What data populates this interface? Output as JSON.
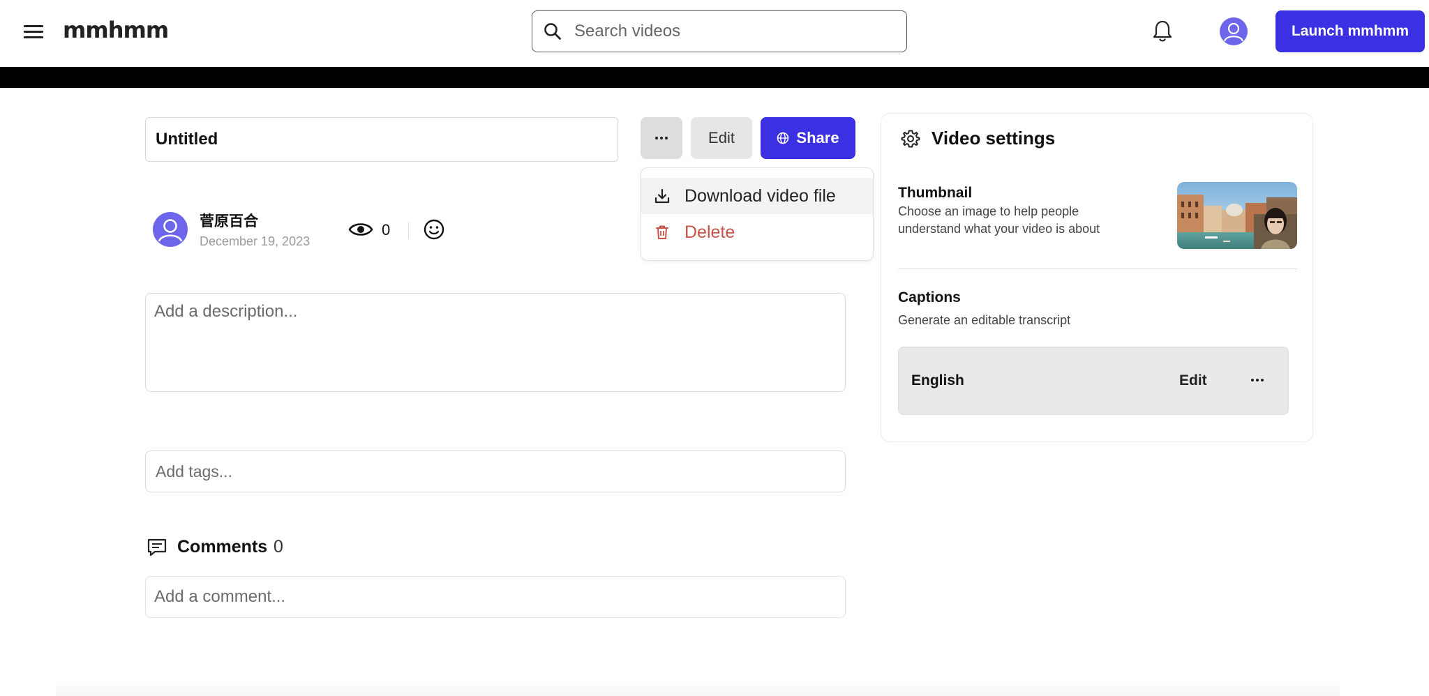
{
  "header": {
    "logo": "mmhmm",
    "search_placeholder": "Search videos",
    "launch_label": "Launch mmhmm"
  },
  "video": {
    "title": "Untitled",
    "actions": {
      "edit_label": "Edit",
      "share_label": "Share"
    },
    "menu": {
      "download_label": "Download video file",
      "delete_label": "Delete"
    },
    "author": {
      "name": "菅原百合",
      "date": "December 19, 2023"
    },
    "views": "0",
    "description_placeholder": "Add a description...",
    "tags_placeholder": "Add tags..."
  },
  "comments": {
    "label": "Comments",
    "count": "0",
    "placeholder": "Add a comment..."
  },
  "settings": {
    "title": "Video settings",
    "thumbnail": {
      "title": "Thumbnail",
      "description": "Choose an image to help people understand what your video is about"
    },
    "captions": {
      "title": "Captions",
      "description": "Generate an editable transcript",
      "language": "English",
      "edit_label": "Edit"
    }
  },
  "colors": {
    "accent": "#3b30e2",
    "danger": "#c9524a",
    "avatar": "#6e66ea"
  },
  "icons": [
    "menu-icon",
    "search-icon",
    "bell-icon",
    "avatar",
    "more-icon",
    "globe-icon",
    "download-icon",
    "trash-icon",
    "eye-icon",
    "emoji-icon",
    "comments-icon",
    "gear-icon"
  ]
}
